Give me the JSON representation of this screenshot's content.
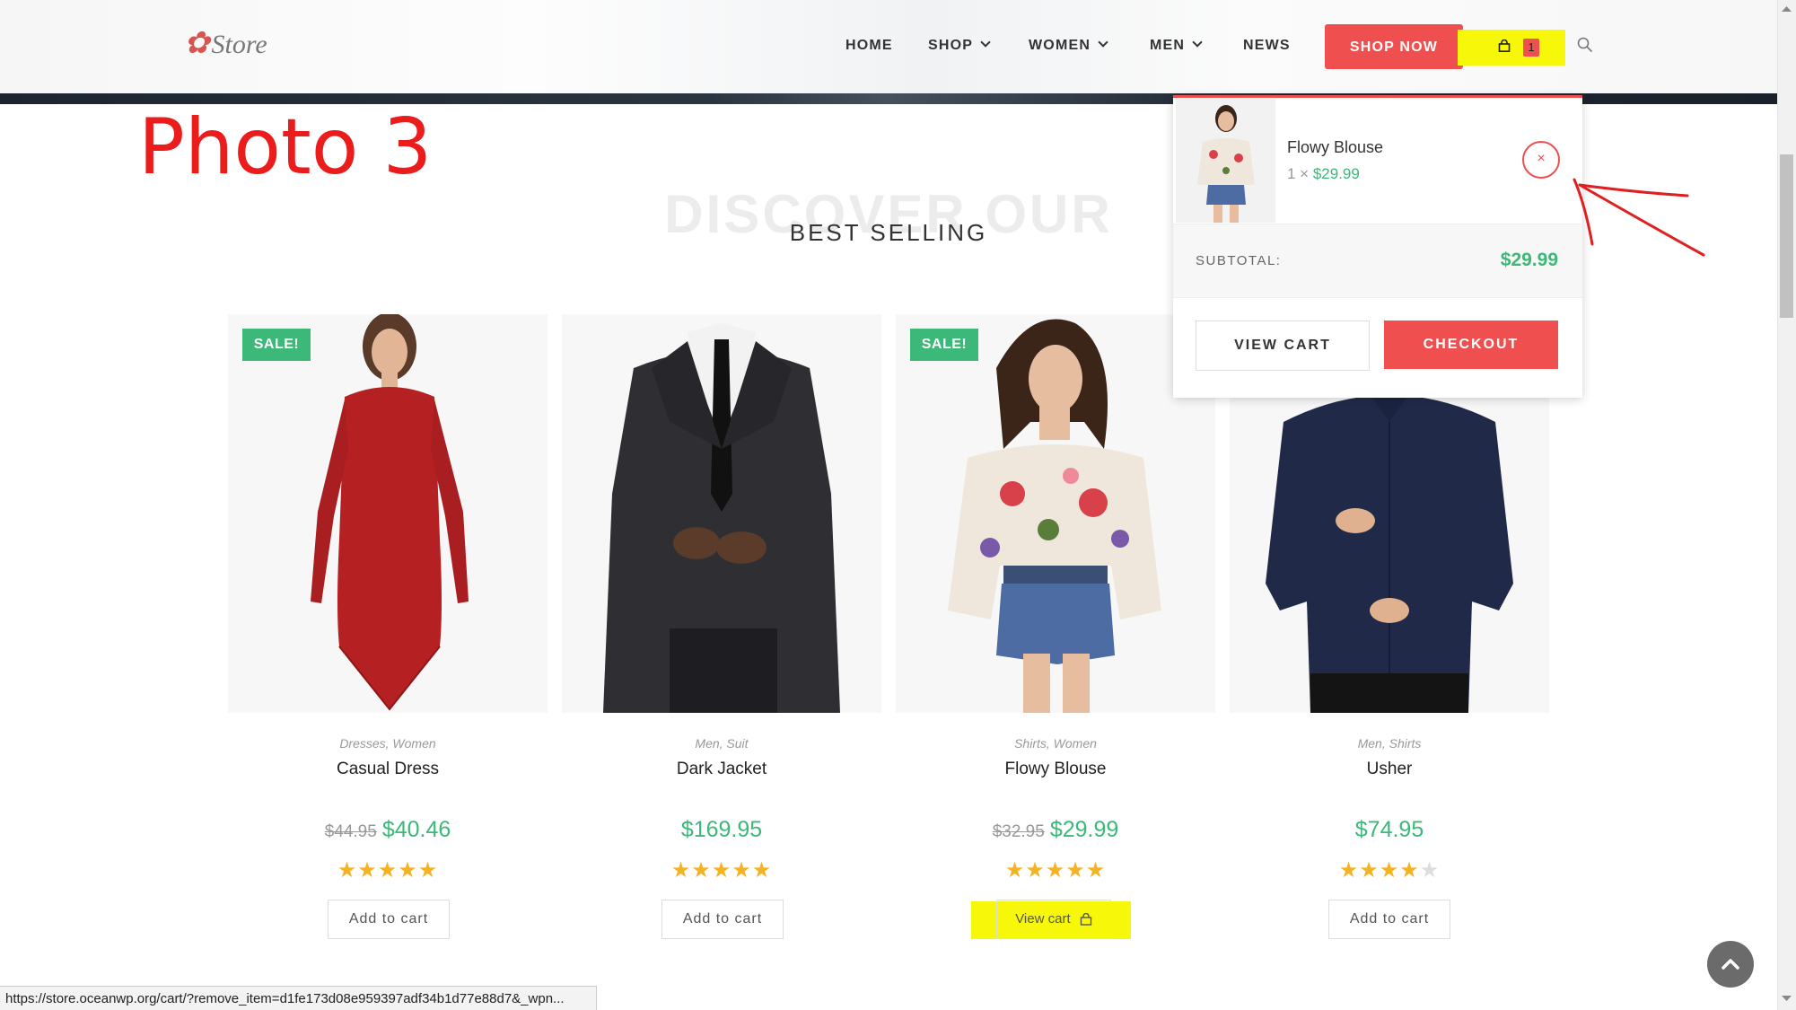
{
  "header": {
    "logo_text": "Store",
    "nav": [
      {
        "label": "HOME",
        "dropdown": false
      },
      {
        "label": "SHOP",
        "dropdown": true
      },
      {
        "label": "WOMEN",
        "dropdown": true
      },
      {
        "label": "MEN",
        "dropdown": true
      },
      {
        "label": "NEWS",
        "dropdown": false
      }
    ],
    "shop_now_label": "SHOP NOW",
    "cart_count": "1",
    "highlight_color": "#f7f709"
  },
  "annotation": {
    "label": "Photo 3",
    "color": "#ea1c1c"
  },
  "section": {
    "ghost_title": "DISCOVER OUR",
    "title": "BEST SELLING"
  },
  "products": [
    {
      "name": "Casual Dress",
      "categories": "Dresses, Women",
      "sale": true,
      "sale_label": "SALE!",
      "old_price": "$44.95",
      "price": "$40.46",
      "rating": 5,
      "stars": "★★★★★",
      "button": "Add to cart"
    },
    {
      "name": "Dark Jacket",
      "categories": "Men, Suit",
      "sale": false,
      "old_price": "",
      "price": "$169.95",
      "rating": 5,
      "stars": "★★★★★",
      "button": "Add to cart"
    },
    {
      "name": "Flowy Blouse",
      "categories": "Shirts, Women",
      "sale": true,
      "sale_label": "SALE!",
      "old_price": "$32.95",
      "price": "$29.99",
      "rating": 5,
      "stars": "★★★★★",
      "button": "View cart"
    },
    {
      "name": "Usher",
      "categories": "Men, Shirts",
      "sale": false,
      "old_price": "",
      "price": "$74.95",
      "rating": 4,
      "stars_on": "★★★★",
      "stars_off": "★",
      "button": "Add to cart"
    }
  ],
  "mini_cart": {
    "item_name": "Flowy Blouse",
    "item_qty": "1 ×",
    "item_price": "$29.99",
    "remove_symbol": "×",
    "subtotal_label": "SUBTOTAL:",
    "subtotal_value": "$29.99",
    "view_cart_label": "VIEW CART",
    "checkout_label": "CHECKOUT"
  },
  "status_bar": {
    "url": "https://store.oceanwp.org/cart/?remove_item=d1fe173d08e959397adf34b1d77e88d7&_wpn..."
  },
  "colors": {
    "accent": "#ef4f4f",
    "price_green": "#3cb878",
    "star": "#f5b323"
  },
  "icons": [
    "cart-icon",
    "search-icon",
    "chevron-down-icon",
    "close-icon",
    "arrow-up-icon",
    "bag-icon"
  ]
}
